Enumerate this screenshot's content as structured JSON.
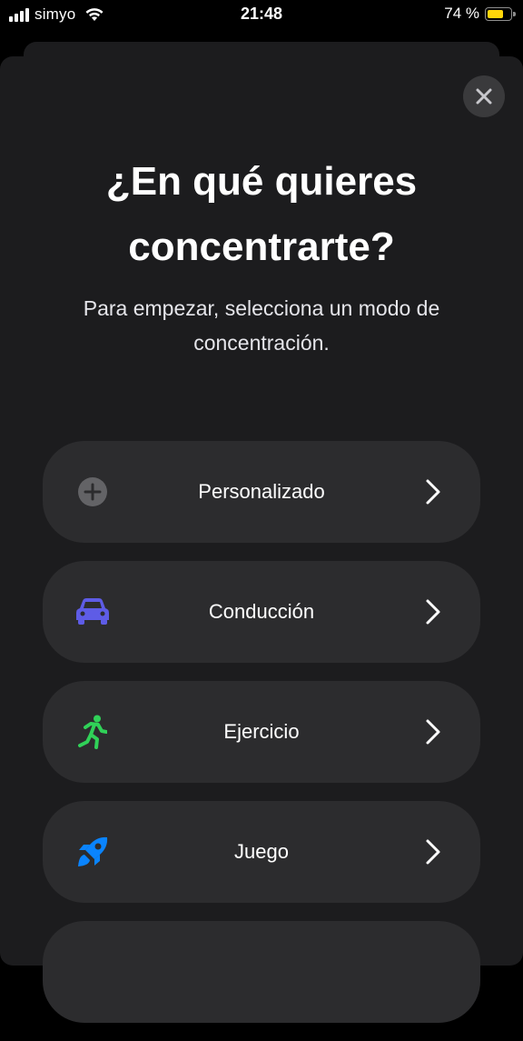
{
  "status_bar": {
    "carrier": "simyo",
    "time": "21:48",
    "battery_percent": "74 %",
    "battery_level": 0.74,
    "signal_bars": 4
  },
  "sheet": {
    "title_line1": "¿En qué quieres",
    "title_line2": "concentrarte?",
    "subtitle_line1": "Para empezar, selecciona un modo de",
    "subtitle_line2": "concentración.",
    "close_icon": "close-icon"
  },
  "modes": [
    {
      "label": "Personalizado",
      "icon": "plus-circle-icon",
      "color": "#8e8e93"
    },
    {
      "label": "Conducción",
      "icon": "car-icon",
      "color": "#5e5ce6"
    },
    {
      "label": "Ejercicio",
      "icon": "running-figure-icon",
      "color": "#30d158"
    },
    {
      "label": "Juego",
      "icon": "rocket-icon",
      "color": "#0a84ff"
    }
  ],
  "colors": {
    "background": "#000000",
    "sheet": "#1c1c1e",
    "row": "#2c2c2e",
    "battery": "#ffd60a"
  }
}
